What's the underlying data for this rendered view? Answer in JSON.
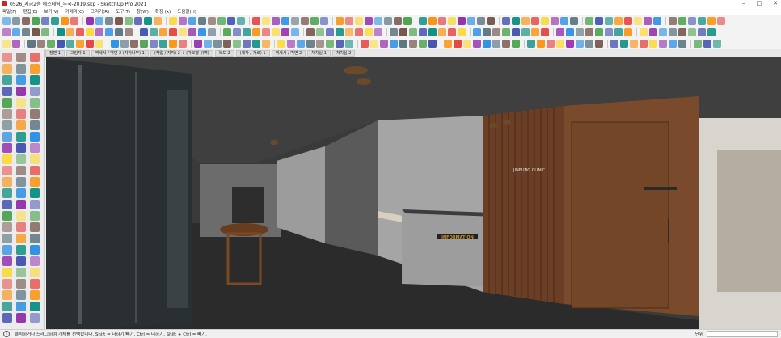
{
  "window": {
    "title": "0526_지금2층 에스테틱_두국-2019.skp - SketchUp Pro 2021",
    "controls": [
      "–",
      "□",
      "✕"
    ]
  },
  "menu": [
    "파일(F)",
    "편집(E)",
    "보기(V)",
    "카메라(C)",
    "그리기(R)",
    "도구(T)",
    "창(W)",
    "확장 (x)",
    "도움말(H)"
  ],
  "scene_tabs": [
    "장면 1",
    "그림자 1",
    "엑세서 / 벽면 2 (자작나무) 1",
    "(작업 / 자작) 2 + (가로형 뒤벽)",
    "복도 2",
    "(제작 / 가로) 1",
    "엑세서 / 벽면 2",
    "처치실 1",
    "처치실 2"
  ],
  "viewport": {
    "reception_sign": "INFORMATION",
    "wall_sign": "JINEUNG CLINIC"
  },
  "statusbar": {
    "info_icon": "i",
    "message": "클릭하거나 드래그하여 개체를 선택합니다. Shift = 더하기/빼기, Ctrl = 더하기, Shift + Ctrl = 빼기.",
    "measure_label": "단위"
  },
  "colors": {
    "accent_blue": "#1e88e5",
    "wood": "#6b3f26",
    "granite": "#a8a8a8",
    "floor": "#2e2e2e"
  }
}
